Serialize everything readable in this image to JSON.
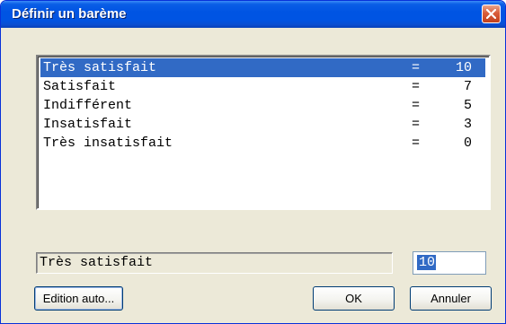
{
  "window": {
    "title": "Définir un barème",
    "close_icon": "close-icon"
  },
  "list": {
    "items": [
      {
        "label": "Très satisfait",
        "eq": "=",
        "value": "10",
        "selected": true
      },
      {
        "label": "Satisfait",
        "eq": "=",
        "value": "7",
        "selected": false
      },
      {
        "label": "Indifférent",
        "eq": "=",
        "value": "5",
        "selected": false
      },
      {
        "label": "Insatisfait",
        "eq": "=",
        "value": "3",
        "selected": false
      },
      {
        "label": "Très insatisfait",
        "eq": "=",
        "value": "0",
        "selected": false
      }
    ]
  },
  "editor": {
    "label_value": "Très satisfait",
    "score_value": "10"
  },
  "buttons": {
    "edition_auto": "Edition auto...",
    "ok": "OK",
    "cancel": "Annuler"
  },
  "colors": {
    "selection": "#316ac5",
    "titlebar": "#0054e3",
    "dialog_bg": "#ece9d8"
  }
}
